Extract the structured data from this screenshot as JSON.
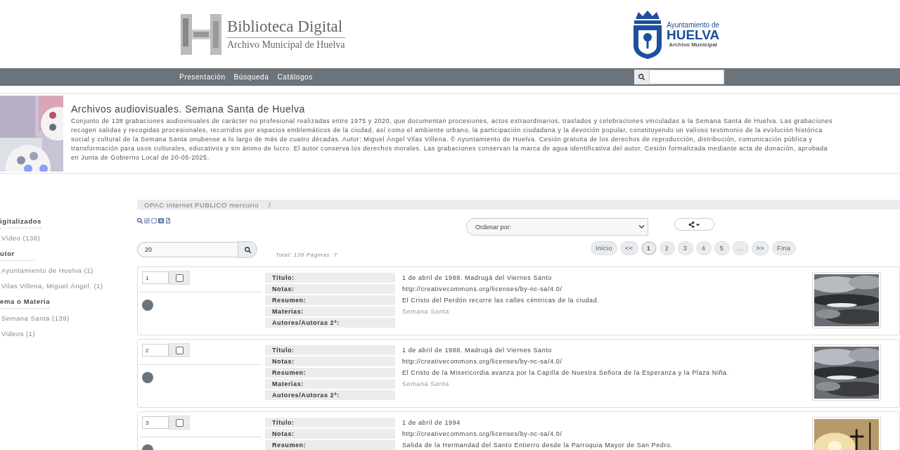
{
  "header": {
    "logo_title": "Biblioteca Digital",
    "logo_subtitle": "Archivo Municipal de Huelva",
    "partner_lines": [
      "Ayuntamiento de",
      "HUELVA",
      "Archivo Municipal"
    ]
  },
  "nav": {
    "items": [
      "Presentación",
      "Búsqueda",
      "Catálogos"
    ]
  },
  "collection": {
    "title": "Archivos audiovisuales. Semana Santa de Huelva",
    "description_lines": [
      "Conjunto de 138 grabaciones audiovisuales de carácter no profesional realizadas entre 1975 y 2020, que documentan procesiones, actos extraordinarios, traslados y celebraciones vinculadas a la Semana Santa de Huelva. Las grabaciones",
      "recogen salidas y recogidas procesionales, recorridos por espacios emblemáticos de la ciudad, así como el ambiente urbano, la participación ciudadana y la devoción popular, constituyendo un valioso testimonio de la evolución histórica",
      "social y cultural de la Semana Santa onubense a lo largo de más de cuatro décadas. Autor: Miguel Ángel Vilas Villena. © Ayuntamiento de Huelva. Cesión gratuita de los derechos de reproducción, distribución, comunicación pública y",
      "transformación para usos culturales, educativos y sin ánimo de lucro. El autor conserva los derechos morales. Las grabaciones conservan la marca de agua identificativa del autor. Cesión formalizada mediante acta de donación, aprobada",
      "en Junta de Gobierno Local de 20-05-2025."
    ]
  },
  "sidebar": {
    "facets": [
      {
        "heading": "igitalizados",
        "items": [
          "Vídeo (138)"
        ]
      },
      {
        "heading": "utor",
        "items": [
          "Ayuntamiento de Huelva (1)",
          "Vilas Villena, Miguel Ángel. (1)"
        ]
      },
      {
        "heading": "ema o Materia",
        "items": [
          "Semana Santa (139)",
          "Videos (1)"
        ]
      }
    ]
  },
  "breadcrumb": {
    "items": [
      "OPAC Internet PUBLICO mercurio"
    ],
    "separator": "/"
  },
  "sort": {
    "value": "Ordenar por:"
  },
  "per_page": {
    "value": "20"
  },
  "totals": "Total: 139 Páginas: 7",
  "pagination": [
    {
      "label": "Inicio",
      "selected": false
    },
    {
      "label": "<<",
      "selected": false
    },
    {
      "label": "1",
      "selected": true
    },
    {
      "label": "2",
      "selected": false
    },
    {
      "label": "3",
      "selected": false
    },
    {
      "label": "4",
      "selected": false
    },
    {
      "label": "5",
      "selected": false
    },
    {
      "label": "...",
      "selected": false
    },
    {
      "label": ">>",
      "selected": false
    },
    {
      "label": "Fina",
      "selected": false
    }
  ],
  "records": [
    {
      "number": "1",
      "checked": false,
      "fields": [
        {
          "label": "Título:",
          "value": "1 de abril de 1988. Madrugá del Viernes Santo",
          "kind": "text"
        },
        {
          "label": "Notas:",
          "value": "http://creativecommons.org/licenses/by-nc-sa/4.0/",
          "kind": "text"
        },
        {
          "label": "Resumen:",
          "value": "El Cristo del Perdón recorre las calles céntricas de la ciudad.",
          "kind": "text"
        },
        {
          "label": "Materias:",
          "value": "Semana Santa",
          "kind": "link"
        },
        {
          "label": "Autores/Autoras 2ª:"
        }
      ]
    },
    {
      "number": "2",
      "checked": false,
      "fields": [
        {
          "label": "Título:",
          "value": "1 de abril de 1988. Madrugá del Viernes Santo",
          "kind": "text"
        },
        {
          "label": "Notas:",
          "value": "http://creativecommons.org/licenses/by-nc-sa/4.0/",
          "kind": "text"
        },
        {
          "label": "Resumen:",
          "value": "El Cristo de la Misericordia avanza por la Capilla de Nuestra Señora de la Esperanza y la Plaza Niña.",
          "kind": "text"
        },
        {
          "label": "Materias:",
          "value": "Semana Santa",
          "kind": "link"
        },
        {
          "label": "Autores/Autoras 2ª:"
        }
      ]
    },
    {
      "number": "3",
      "checked": false,
      "fields": [
        {
          "label": "Título:",
          "value": "1 de abril de 1994",
          "kind": "text"
        },
        {
          "label": "Notas:",
          "value": "http://creativecommons.org/licenses/by-nc-sa/4.0/",
          "kind": "text"
        },
        {
          "label": "Resumen:",
          "value": "Salida de la Hermandad del Santo Entierro desde la Parroquia Mayor de San Pedro.",
          "kind": "text"
        }
      ]
    }
  ]
}
